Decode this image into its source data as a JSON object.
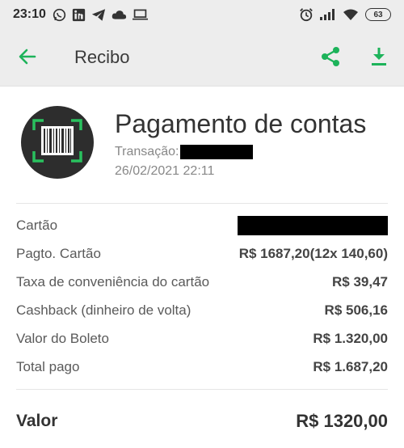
{
  "statusbar": {
    "time": "23:10",
    "battery": "63",
    "left_icons": [
      "whatsapp-icon",
      "linkedin-icon",
      "telegram-icon",
      "cloud-icon",
      "laptop-icon"
    ],
    "right_icons": [
      "alarm-icon",
      "signal-icon",
      "wifi-icon",
      "battery-icon"
    ]
  },
  "appbar": {
    "title": "Recibo",
    "accent_color": "#1db35a"
  },
  "receipt": {
    "title": "Pagamento de contas",
    "transaction_label": "Transação:",
    "date": "26/02/2021 22:11",
    "icon": "barcode-icon"
  },
  "details": [
    {
      "label": "Cartão",
      "value": ""
    },
    {
      "label": "Pagto. Cartão",
      "value": "R$ 1687,20(12x 140,60)"
    },
    {
      "label": "Taxa de conveniência do cartão",
      "value": "R$ 39,47"
    },
    {
      "label": "Cashback (dinheiro de volta)",
      "value": "R$ 506,16"
    },
    {
      "label": "Valor do Boleto",
      "value": "R$ 1.320,00"
    },
    {
      "label": "Total pago",
      "value": "R$ 1.687,20"
    }
  ],
  "total": {
    "label": "Valor",
    "value": "R$ 1320,00"
  }
}
